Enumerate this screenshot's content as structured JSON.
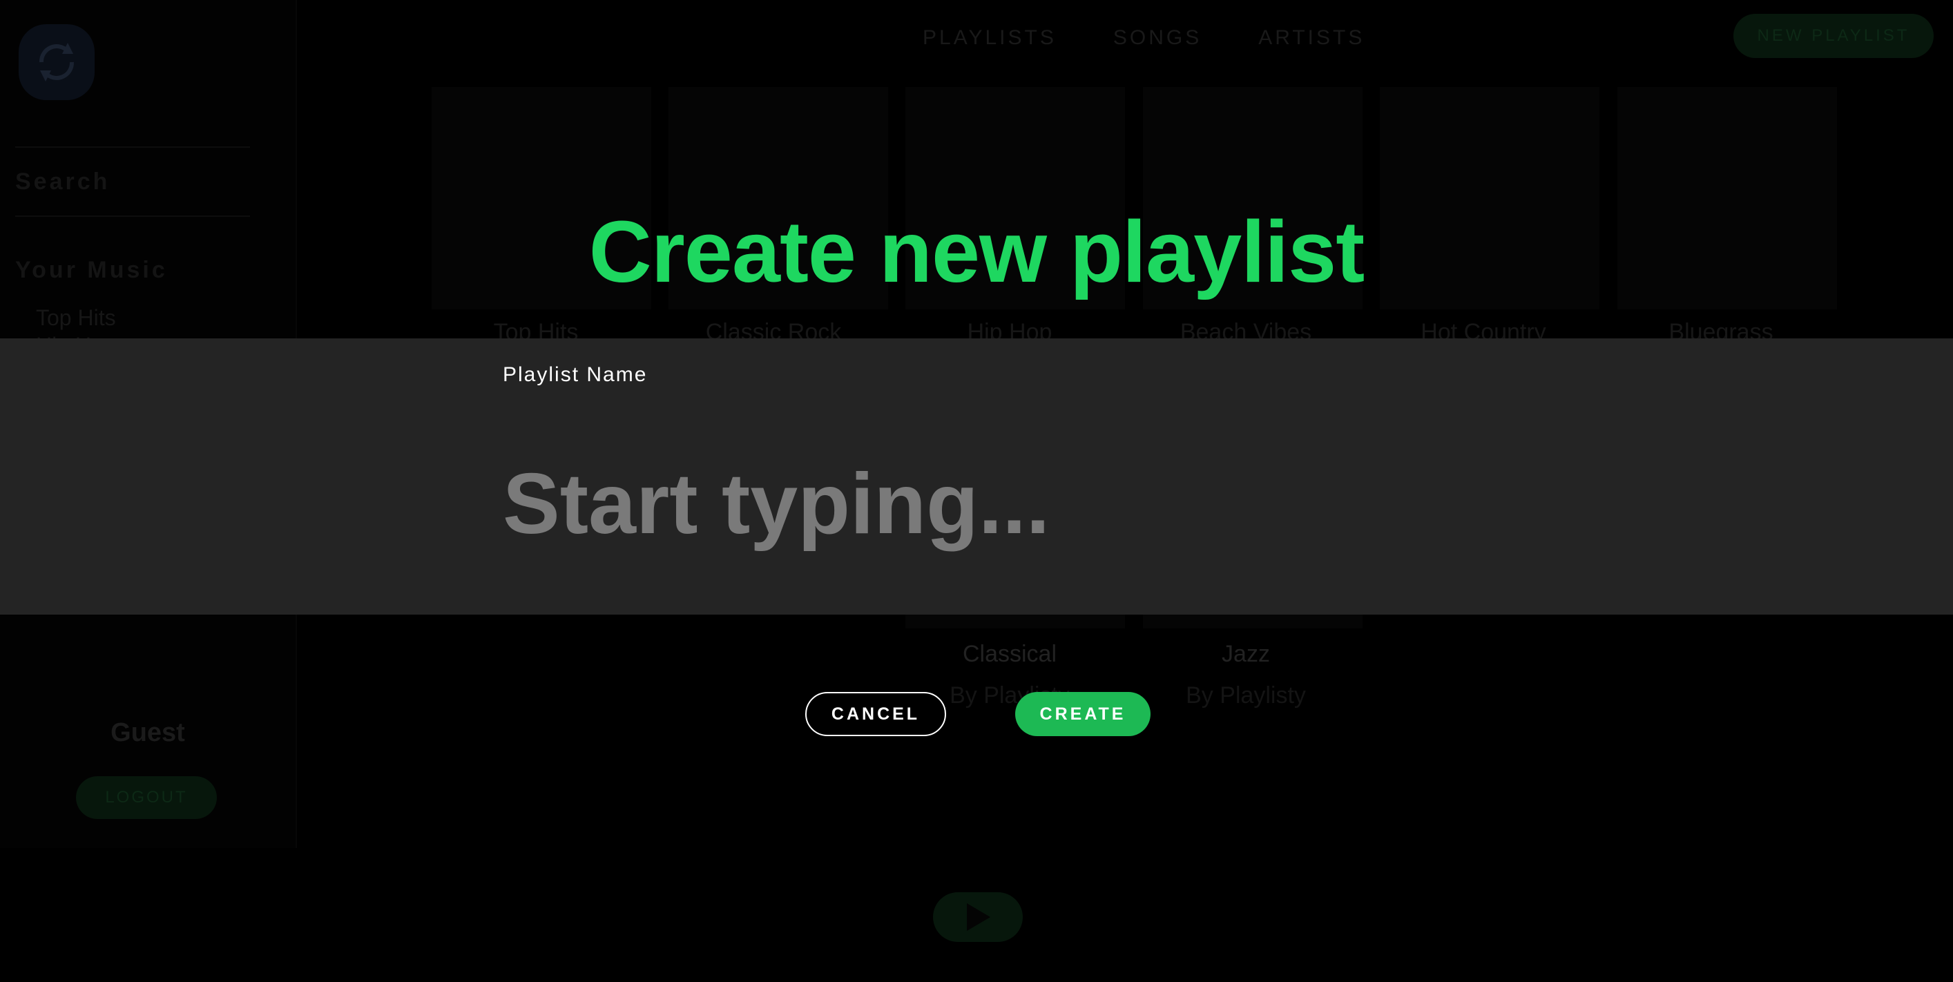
{
  "background": {
    "sidebar": {
      "search_label": "Search",
      "your_music_label": "Your Music",
      "items": [
        "Top Hits",
        "Hip Hop"
      ],
      "user_name": "Guest",
      "logout_label": "LOGOUT"
    },
    "nav": {
      "tabs": [
        "PLAYLISTS",
        "SONGS",
        "ARTISTS"
      ],
      "new_playlist_label": "NEW PLAYLIST"
    },
    "playlists": [
      "Top Hits",
      "Classic Rock",
      "Hip Hop",
      "Beach Vibes",
      "Hot Country",
      "Bluegrass"
    ],
    "lower_playlists": [
      {
        "title": "Classical",
        "subtitle": "By Playlisty"
      },
      {
        "title": "Jazz",
        "subtitle": "By Playlisty"
      }
    ]
  },
  "modal": {
    "title": "Create new playlist",
    "field_label": "Playlist Name",
    "input_value": "",
    "input_placeholder": "Start typing...",
    "cancel_label": "CANCEL",
    "create_label": "CREATE"
  },
  "colors": {
    "accent_green": "#1ed760",
    "button_green": "#1db954",
    "band_gray": "#242424"
  },
  "icons": [
    "sync-logo-icon",
    "play-icon"
  ]
}
